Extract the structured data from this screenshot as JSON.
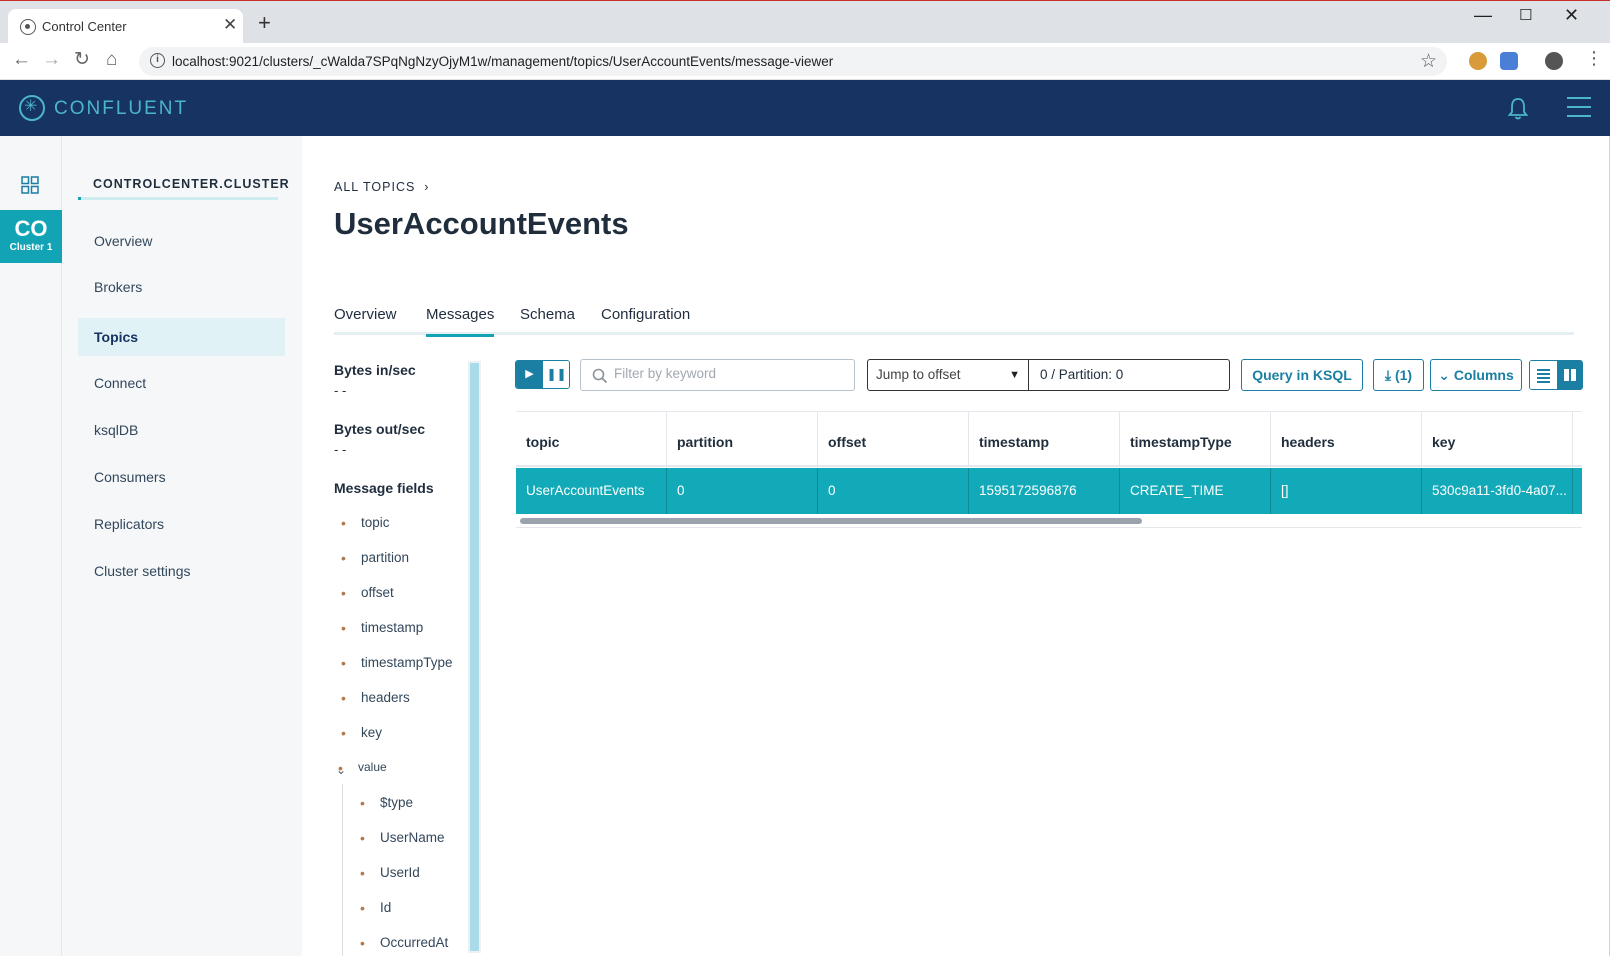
{
  "browser": {
    "tab_title": "Control Center",
    "tab_close": "✕",
    "new_tab": "+",
    "url": "localhost:9021/clusters/_cWalda7SPqNgNzyOjyM1w/management/topics/UserAccountEvents/message-viewer",
    "icons": [
      "back-arrow-icon",
      "forward-arrow-icon",
      "reload-icon",
      "home-icon",
      "info-icon",
      "star-icon",
      "cookie-extension-icon",
      "translate-extension-icon",
      "profile-icon",
      "kebab-menu-icon"
    ]
  },
  "app": {
    "brand": "CONFLUENT",
    "brand_color": "#4bb5c9",
    "header_color": "#173361",
    "accent_color": "#12a3b5"
  },
  "cluster": {
    "code": "CO",
    "name": "Cluster 1"
  },
  "sidenav": {
    "title": "CONTROLCENTER.CLUSTER",
    "items": [
      {
        "label": "Overview"
      },
      {
        "label": "Brokers"
      },
      {
        "label": "Topics",
        "active": true
      },
      {
        "label": "Connect"
      },
      {
        "label": "ksqlDB"
      },
      {
        "label": "Consumers"
      },
      {
        "label": "Replicators"
      },
      {
        "label": "Cluster settings"
      }
    ]
  },
  "main": {
    "breadcrumb": "ALL TOPICS",
    "title": "UserAccountEvents",
    "tabs": [
      {
        "label": "Overview"
      },
      {
        "label": "Messages",
        "active": true
      },
      {
        "label": "Schema"
      },
      {
        "label": "Configuration"
      }
    ]
  },
  "fields_panel": {
    "bytes_in_label": "Bytes in/sec",
    "bytes_in_value": "- -",
    "bytes_out_label": "Bytes out/sec",
    "bytes_out_value": "- -",
    "message_fields_label": "Message fields",
    "fields": [
      "topic",
      "partition",
      "offset",
      "timestamp",
      "timestampType",
      "headers",
      "key"
    ],
    "value_label": "value",
    "value_fields": [
      "$type",
      "UserName",
      "UserId",
      "Id",
      "OccurredAt"
    ]
  },
  "controls": {
    "filter_placeholder": "Filter by keyword",
    "offset_mode": "Jump to offset",
    "offset_value": "0 / Partition: 0",
    "query_button": "Query in KSQL",
    "download_button": "(1)",
    "columns_button": "Columns"
  },
  "table": {
    "columns": [
      "topic",
      "partition",
      "offset",
      "timestamp",
      "timestampType",
      "headers",
      "key"
    ],
    "rows": [
      [
        "UserAccountEvents",
        "0",
        "0",
        "1595172596876",
        "CREATE_TIME",
        "[]",
        "530c9a11-3fd0-4a07..."
      ]
    ]
  }
}
